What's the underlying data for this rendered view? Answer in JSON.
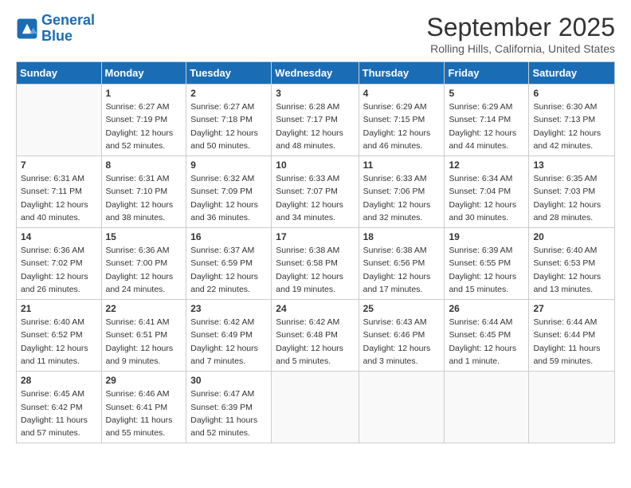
{
  "header": {
    "logo_line1": "General",
    "logo_line2": "Blue",
    "month": "September 2025",
    "location": "Rolling Hills, California, United States"
  },
  "weekdays": [
    "Sunday",
    "Monday",
    "Tuesday",
    "Wednesday",
    "Thursday",
    "Friday",
    "Saturday"
  ],
  "weeks": [
    [
      {
        "day": "",
        "info": ""
      },
      {
        "day": "1",
        "info": "Sunrise: 6:27 AM\nSunset: 7:19 PM\nDaylight: 12 hours\nand 52 minutes."
      },
      {
        "day": "2",
        "info": "Sunrise: 6:27 AM\nSunset: 7:18 PM\nDaylight: 12 hours\nand 50 minutes."
      },
      {
        "day": "3",
        "info": "Sunrise: 6:28 AM\nSunset: 7:17 PM\nDaylight: 12 hours\nand 48 minutes."
      },
      {
        "day": "4",
        "info": "Sunrise: 6:29 AM\nSunset: 7:15 PM\nDaylight: 12 hours\nand 46 minutes."
      },
      {
        "day": "5",
        "info": "Sunrise: 6:29 AM\nSunset: 7:14 PM\nDaylight: 12 hours\nand 44 minutes."
      },
      {
        "day": "6",
        "info": "Sunrise: 6:30 AM\nSunset: 7:13 PM\nDaylight: 12 hours\nand 42 minutes."
      }
    ],
    [
      {
        "day": "7",
        "info": "Sunrise: 6:31 AM\nSunset: 7:11 PM\nDaylight: 12 hours\nand 40 minutes."
      },
      {
        "day": "8",
        "info": "Sunrise: 6:31 AM\nSunset: 7:10 PM\nDaylight: 12 hours\nand 38 minutes."
      },
      {
        "day": "9",
        "info": "Sunrise: 6:32 AM\nSunset: 7:09 PM\nDaylight: 12 hours\nand 36 minutes."
      },
      {
        "day": "10",
        "info": "Sunrise: 6:33 AM\nSunset: 7:07 PM\nDaylight: 12 hours\nand 34 minutes."
      },
      {
        "day": "11",
        "info": "Sunrise: 6:33 AM\nSunset: 7:06 PM\nDaylight: 12 hours\nand 32 minutes."
      },
      {
        "day": "12",
        "info": "Sunrise: 6:34 AM\nSunset: 7:04 PM\nDaylight: 12 hours\nand 30 minutes."
      },
      {
        "day": "13",
        "info": "Sunrise: 6:35 AM\nSunset: 7:03 PM\nDaylight: 12 hours\nand 28 minutes."
      }
    ],
    [
      {
        "day": "14",
        "info": "Sunrise: 6:36 AM\nSunset: 7:02 PM\nDaylight: 12 hours\nand 26 minutes."
      },
      {
        "day": "15",
        "info": "Sunrise: 6:36 AM\nSunset: 7:00 PM\nDaylight: 12 hours\nand 24 minutes."
      },
      {
        "day": "16",
        "info": "Sunrise: 6:37 AM\nSunset: 6:59 PM\nDaylight: 12 hours\nand 22 minutes."
      },
      {
        "day": "17",
        "info": "Sunrise: 6:38 AM\nSunset: 6:58 PM\nDaylight: 12 hours\nand 19 minutes."
      },
      {
        "day": "18",
        "info": "Sunrise: 6:38 AM\nSunset: 6:56 PM\nDaylight: 12 hours\nand 17 minutes."
      },
      {
        "day": "19",
        "info": "Sunrise: 6:39 AM\nSunset: 6:55 PM\nDaylight: 12 hours\nand 15 minutes."
      },
      {
        "day": "20",
        "info": "Sunrise: 6:40 AM\nSunset: 6:53 PM\nDaylight: 12 hours\nand 13 minutes."
      }
    ],
    [
      {
        "day": "21",
        "info": "Sunrise: 6:40 AM\nSunset: 6:52 PM\nDaylight: 12 hours\nand 11 minutes."
      },
      {
        "day": "22",
        "info": "Sunrise: 6:41 AM\nSunset: 6:51 PM\nDaylight: 12 hours\nand 9 minutes."
      },
      {
        "day": "23",
        "info": "Sunrise: 6:42 AM\nSunset: 6:49 PM\nDaylight: 12 hours\nand 7 minutes."
      },
      {
        "day": "24",
        "info": "Sunrise: 6:42 AM\nSunset: 6:48 PM\nDaylight: 12 hours\nand 5 minutes."
      },
      {
        "day": "25",
        "info": "Sunrise: 6:43 AM\nSunset: 6:46 PM\nDaylight: 12 hours\nand 3 minutes."
      },
      {
        "day": "26",
        "info": "Sunrise: 6:44 AM\nSunset: 6:45 PM\nDaylight: 12 hours\nand 1 minute."
      },
      {
        "day": "27",
        "info": "Sunrise: 6:44 AM\nSunset: 6:44 PM\nDaylight: 11 hours\nand 59 minutes."
      }
    ],
    [
      {
        "day": "28",
        "info": "Sunrise: 6:45 AM\nSunset: 6:42 PM\nDaylight: 11 hours\nand 57 minutes."
      },
      {
        "day": "29",
        "info": "Sunrise: 6:46 AM\nSunset: 6:41 PM\nDaylight: 11 hours\nand 55 minutes."
      },
      {
        "day": "30",
        "info": "Sunrise: 6:47 AM\nSunset: 6:39 PM\nDaylight: 11 hours\nand 52 minutes."
      },
      {
        "day": "",
        "info": ""
      },
      {
        "day": "",
        "info": ""
      },
      {
        "day": "",
        "info": ""
      },
      {
        "day": "",
        "info": ""
      }
    ]
  ]
}
